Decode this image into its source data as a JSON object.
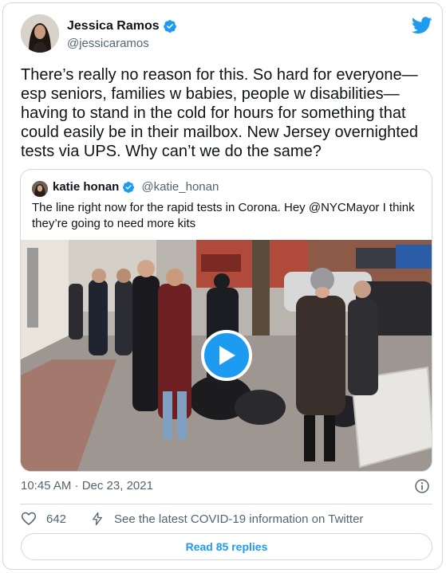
{
  "tweet": {
    "author": {
      "display_name": "Jessica Ramos",
      "handle": "@jessicaramos",
      "verified": true
    },
    "text": "There’s really no reason for this. So hard for everyone— esp seniors, families w babies, people w disabilities— having to stand in the cold for hours for something that could easily be in their mailbox. New Jersey overnighted tests via UPS. Why can’t we do the same?",
    "timestamp": "10:45 AM · Dec 23, 2021",
    "like_count": "642",
    "covid_link": "See the latest COVID-19 information on Twitter",
    "read_replies": "Read 85 replies"
  },
  "quoted_tweet": {
    "author": {
      "display_name": "katie honan",
      "handle": "@katie_honan",
      "verified": true
    },
    "text": "The line right now for the rapid tests in Corona. Hey @NYCMayor I think they’re going to need more kits",
    "media_type": "video"
  },
  "colors": {
    "accent": "#1d9bf0",
    "text": "#0f1419",
    "secondary": "#536471",
    "border": "#cfd9de"
  },
  "icons": [
    "verified-badge-icon",
    "twitter-bird-icon",
    "play-icon",
    "info-icon",
    "heart-icon",
    "lightning-bolt-icon"
  ]
}
